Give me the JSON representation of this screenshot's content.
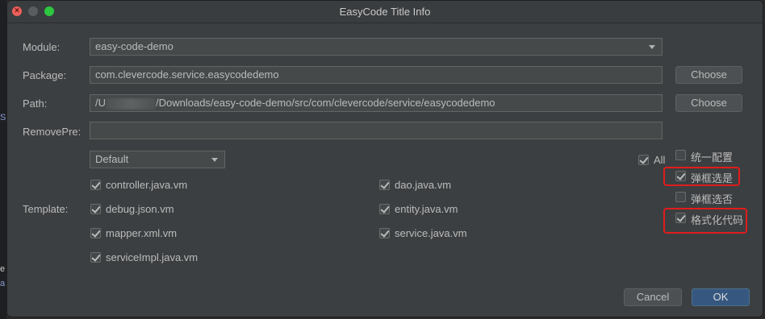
{
  "window": {
    "title": "EasyCode Title Info"
  },
  "form": {
    "module_label": "Module:",
    "module_value": "easy-code-demo",
    "package_label": "Package:",
    "package_value": "com.clevercode.service.easycodedemo",
    "path_label": "Path:",
    "path_prefix": "/U",
    "path_value": "/Downloads/easy-code-demo/src/com/clevercode/service/easycodedemo",
    "removepre_label": "RemovePre:",
    "removepre_value": "",
    "choose_label": "Choose",
    "group_value": "Default",
    "all_label": "All",
    "template_label": "Template:"
  },
  "templates": [
    {
      "name": "controller.java.vm",
      "checked": true
    },
    {
      "name": "dao.java.vm",
      "checked": true
    },
    {
      "name": "debug.json.vm",
      "checked": true
    },
    {
      "name": "entity.java.vm",
      "checked": true
    },
    {
      "name": "mapper.xml.vm",
      "checked": true
    },
    {
      "name": "service.java.vm",
      "checked": true
    },
    {
      "name": "serviceImpl.java.vm",
      "checked": true
    }
  ],
  "options": [
    {
      "label": "统一配置",
      "checked": false
    },
    {
      "label": "弹框选是",
      "checked": true
    },
    {
      "label": "弹框选否",
      "checked": false
    },
    {
      "label": "格式化代码",
      "checked": true
    }
  ],
  "buttons": {
    "cancel": "Cancel",
    "ok": "OK"
  },
  "left_gutter": [
    "S",
    "e",
    "a"
  ],
  "colors": {
    "dialog_bg": "#3c3f41",
    "primary_button": "#365880",
    "highlight": "#e01c1c"
  }
}
